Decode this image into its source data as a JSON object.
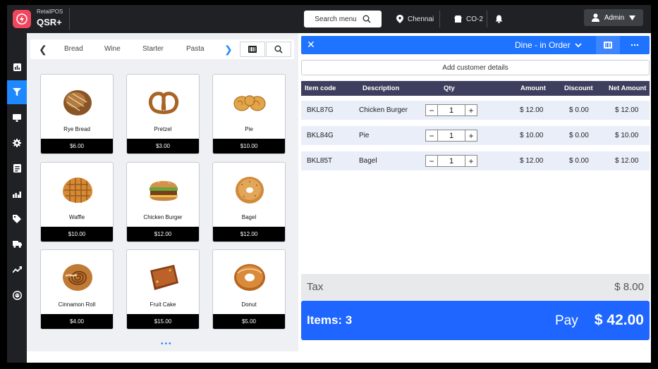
{
  "app": {
    "brand_small": "RetailPOS",
    "brand_big": "QSR+"
  },
  "topbar": {
    "search_label": "Search menu",
    "location": "Chennai",
    "store": "CO-2",
    "user": "Admin"
  },
  "nav": [
    "dashboard-icon",
    "filter-icon",
    "monitor-icon",
    "settings-icon",
    "report-icon",
    "chart-icon",
    "tag-icon",
    "truck-icon",
    "trend-icon",
    "support-icon"
  ],
  "categories": [
    "Bread",
    "Wine",
    "Starter",
    "Pasta"
  ],
  "products": [
    {
      "name": "Rye Bread",
      "price": "$6.00"
    },
    {
      "name": "Pretzel",
      "price": "$3.00"
    },
    {
      "name": "Pie",
      "price": "$10.00"
    },
    {
      "name": "Waffle",
      "price": "$10.00"
    },
    {
      "name": "Chicken Burger",
      "price": "$12.00"
    },
    {
      "name": "Bagel",
      "price": "$12.00"
    },
    {
      "name": "Cinnamon Roll",
      "price": "$4.00"
    },
    {
      "name": "Fruit Cake",
      "price": "$15.00"
    },
    {
      "name": "Donut",
      "price": "$5.00"
    }
  ],
  "order": {
    "mode": "Dine - in Order",
    "add_customer": "Add customer details",
    "columns": [
      "Item code",
      "Description",
      "Qty",
      "Amount",
      "Discount",
      "Net Amount"
    ],
    "rows": [
      {
        "code": "BKL87G",
        "desc": "Chicken Burger",
        "qty": "1",
        "amount": "$ 12.00",
        "discount": "$ 0.00",
        "net": "$ 12.00"
      },
      {
        "code": "BKL84G",
        "desc": "Pie",
        "qty": "1",
        "amount": "$ 10.00",
        "discount": "$ 0.00",
        "net": "$ 10.00"
      },
      {
        "code": "BKL85T",
        "desc": "Bagel",
        "qty": "1",
        "amount": "$ 12.00",
        "discount": "$ 0.00",
        "net": "$ 12.00"
      }
    ],
    "tax_label": "Tax",
    "tax_value": "$ 8.00",
    "items_label": "Items: 3",
    "pay_label": "Pay",
    "total": "$ 42.00"
  },
  "colors": {
    "accent": "#1e73ff",
    "nav_active": "#1e88ff",
    "header_dark": "#1f2125",
    "table_head": "#3e3f5e",
    "logo": "#f0475e"
  }
}
